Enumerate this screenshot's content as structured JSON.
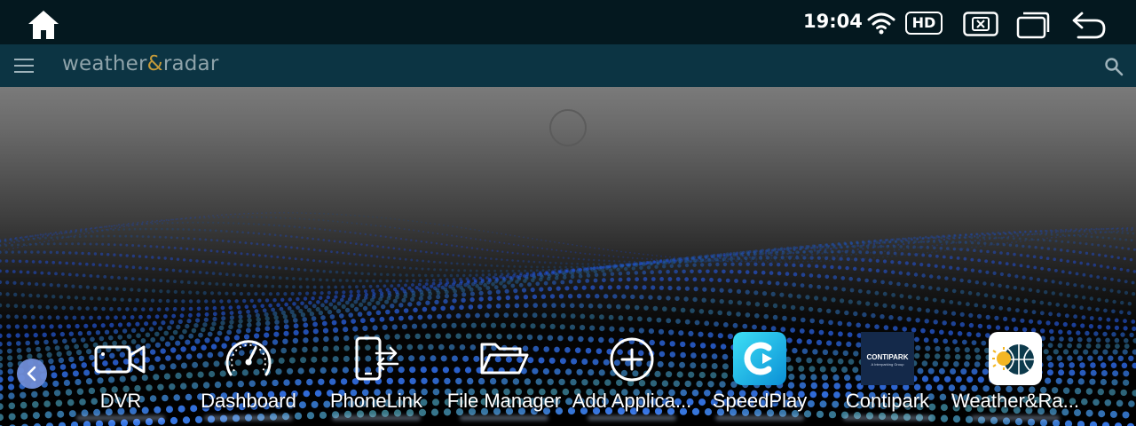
{
  "statusbar": {
    "time": "19:04",
    "hd_label": "HD"
  },
  "appbar": {
    "brand_part1": "weather",
    "brand_amp": "&",
    "brand_part2": "radar"
  },
  "dock": {
    "items": [
      {
        "label": "DVR",
        "icon": "video-camera-icon"
      },
      {
        "label": "Dashboard",
        "icon": "speedometer-icon"
      },
      {
        "label": "PhoneLink",
        "icon": "phone-link-icon"
      },
      {
        "label": "File Manager",
        "icon": "folder-icon"
      },
      {
        "label": "Add Applica...",
        "icon": "add-circle-icon"
      },
      {
        "label": "SpeedPlay",
        "icon": "speedplay-app-icon"
      },
      {
        "label": "Contipark",
        "icon": "contipark-app-icon"
      },
      {
        "label": "Weather&Ra...",
        "icon": "weather-radar-app-icon"
      }
    ]
  },
  "contipark": {
    "logo_name": "CONTIPARK",
    "logo_sub": "A Interparking Group"
  },
  "colors": {
    "statusbar_bg": "#04181f",
    "appbar_bg": "#0c3443",
    "brand_accent": "#c49a3a",
    "wave_blue": "#1a4cff"
  }
}
